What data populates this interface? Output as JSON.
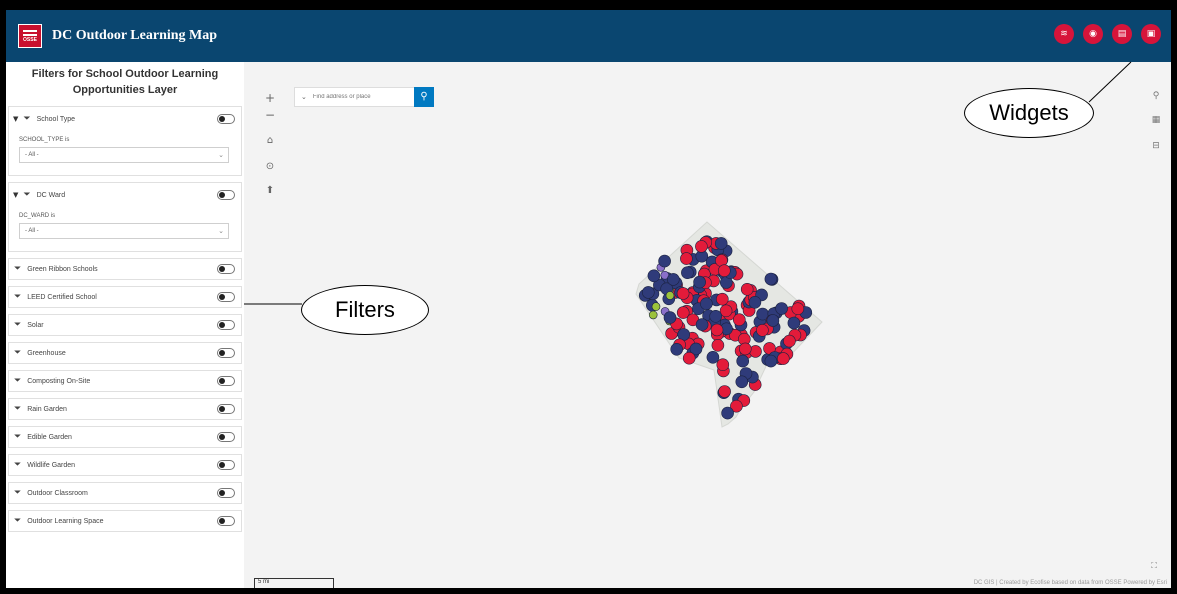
{
  "header": {
    "logo_text": "OSSE",
    "title": "DC Outdoor Learning Map",
    "widgets": [
      {
        "icon": "layers-icon",
        "glyph": "≋"
      },
      {
        "icon": "legend-icon",
        "glyph": "◉"
      },
      {
        "icon": "print-icon",
        "glyph": "▤"
      },
      {
        "icon": "basemap-icon",
        "glyph": "▣"
      }
    ]
  },
  "panel": {
    "title_line1": "Filters for School Outdoor Learning",
    "title_line2": "Opportunities Layer",
    "expanded_filters": [
      {
        "label": "School Type",
        "field_label": "SCHOOL_TYPE is",
        "value": "- All -"
      },
      {
        "label": "DC Ward",
        "field_label": "DC_WARD is",
        "value": "- All -"
      }
    ],
    "toggle_filters": [
      "Green Ribbon Schools",
      "LEED Certified School",
      "Solar",
      "Greenhouse",
      "Composting On-Site",
      "Rain Garden",
      "Edible Garden",
      "Wildlife Garden",
      "Outdoor Classroom",
      "Outdoor Learning Space"
    ]
  },
  "map": {
    "search_placeholder": "Find address or place",
    "scale_label": "5 mi",
    "attribution": "DC GIS | Created by Ecofise based on data from OSSE   Powered by Esri",
    "colors": {
      "red": "#e31b3a",
      "navy": "#2f3b7a",
      "green": "#9bc23c",
      "purple": "#8a6fc9",
      "boundary": "#e5e7e3"
    }
  },
  "annotations": {
    "widgets": "Widgets",
    "filters": "Filters"
  }
}
